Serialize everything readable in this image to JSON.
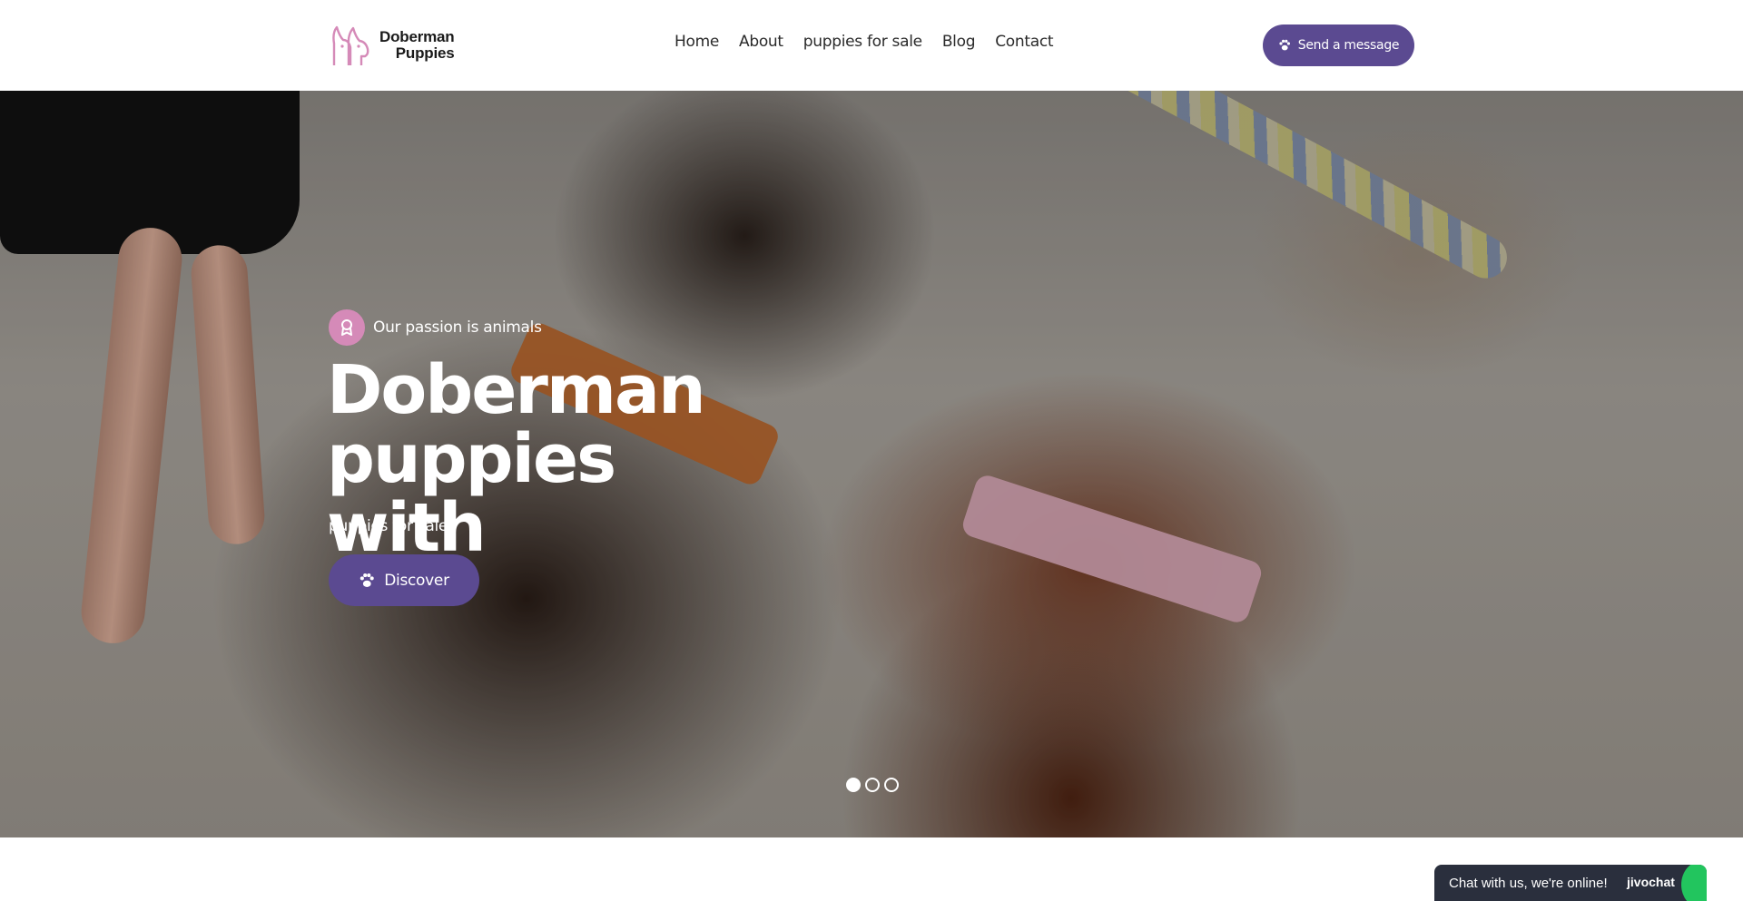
{
  "header": {
    "logo": {
      "line1": "Doberman",
      "line2": "Puppies",
      "icon": "doberman-logo-icon"
    },
    "nav": [
      {
        "label": "Home"
      },
      {
        "label": "About"
      },
      {
        "label": "puppies for sale"
      },
      {
        "label": "Blog"
      },
      {
        "label": "Contact"
      }
    ],
    "cta": {
      "label": "Send a message",
      "icon": "paw-icon"
    }
  },
  "hero": {
    "tagline": "Our passion is animals",
    "tagline_icon": "badge-icon",
    "title_line1": "Doberman puppies",
    "title_line2": "with",
    "subtitle": "puppies for sale",
    "button": {
      "label": "Discover",
      "icon": "paw-icon"
    },
    "slides": {
      "count": 3,
      "active": 1
    }
  },
  "chat": {
    "text": "Chat with us, we're online!",
    "brand": "jivochat"
  },
  "colors": {
    "accent": "#5b4a91",
    "logo_pink": "#d58ab8",
    "chat_bg": "#2a2f3d",
    "chat_green": "#22c55e"
  }
}
